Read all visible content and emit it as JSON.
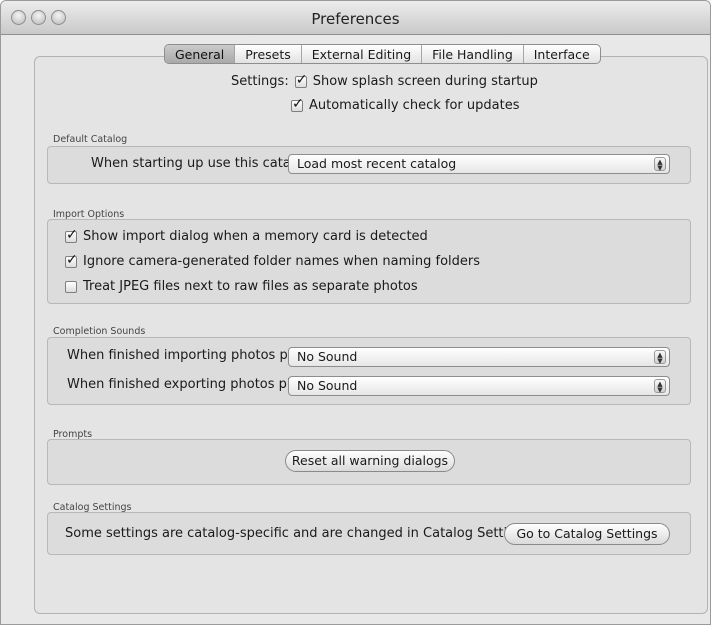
{
  "window": {
    "title": "Preferences"
  },
  "tabs": [
    {
      "label": "General"
    },
    {
      "label": "Presets"
    },
    {
      "label": "External Editing"
    },
    {
      "label": "File Handling"
    },
    {
      "label": "Interface"
    }
  ],
  "settings": {
    "label": "Settings:",
    "show_splash": {
      "label": "Show splash screen during startup",
      "checked": true
    },
    "check_updates": {
      "label": "Automatically check for updates",
      "checked": true
    }
  },
  "default_catalog": {
    "section": "Default Catalog",
    "label": "When starting up use this catalog:",
    "value": "Load most recent catalog"
  },
  "import_options": {
    "section": "Import Options",
    "items": [
      {
        "label": "Show import dialog when a memory card is detected",
        "checked": true
      },
      {
        "label": "Ignore camera-generated folder names when naming folders",
        "checked": true
      },
      {
        "label": "Treat JPEG files next to raw files as separate photos",
        "checked": false
      }
    ]
  },
  "completion_sounds": {
    "section": "Completion Sounds",
    "importing_label": "When finished importing photos play:",
    "importing_value": "No Sound",
    "exporting_label": "When finished exporting photos play:",
    "exporting_value": "No Sound"
  },
  "prompts": {
    "section": "Prompts",
    "reset_button": "Reset all warning dialogs"
  },
  "catalog_settings": {
    "section": "Catalog Settings",
    "text": "Some settings are catalog-specific and are changed in Catalog Settings.",
    "button": "Go to Catalog Settings"
  }
}
